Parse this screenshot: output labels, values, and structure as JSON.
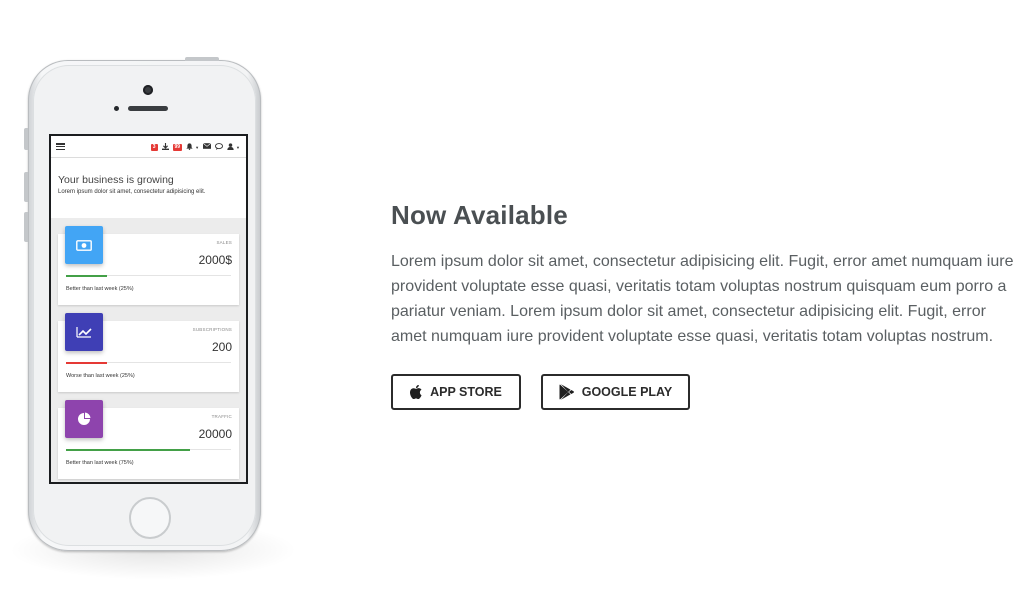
{
  "phone": {
    "app_bar": {
      "badges": [
        "3",
        "99"
      ]
    },
    "hero": {
      "title": "Your business is growing",
      "subtitle": "Lorem ipsum dolor sit amet, consectetur adipisicing elit."
    },
    "cards": [
      {
        "label": "SALES",
        "value": "2000$",
        "footer": "Better than last week (25%)",
        "progress": 0.25,
        "icon": "money-icon",
        "icon_color": "#42a5f5",
        "bar_color": "#43a047"
      },
      {
        "label": "SUBSCRIPTIONS",
        "value": "200",
        "footer": "Worse than last week (25%)",
        "progress": 0.25,
        "icon": "trending-up-icon",
        "icon_color": "#3f3fb5",
        "bar_color": "#e53935"
      },
      {
        "label": "TRAFFIC",
        "value": "20000",
        "footer": "Better than last week (75%)",
        "progress": 0.75,
        "icon": "pie-chart-icon",
        "icon_color": "#8e44ad",
        "bar_color": "#43a047"
      }
    ]
  },
  "section": {
    "title": "Now Available",
    "description": "Lorem ipsum dolor sit amet, consectetur adipisicing elit. Fugit, error amet numquam iure provident voluptate esse quasi, veritatis totam voluptas nostrum quisquam eum porro a pariatur veniam. Lorem ipsum dolor sit amet, consectetur adipisicing elit. Fugit, error amet numquam iure provident voluptate esse quasi, veritatis totam voluptas nostrum."
  },
  "buttons": {
    "app_store": {
      "label": "APP STORE",
      "icon": "apple-icon"
    },
    "google_play": {
      "label": "GOOGLE PLAY",
      "icon": "play-store-icon"
    }
  }
}
